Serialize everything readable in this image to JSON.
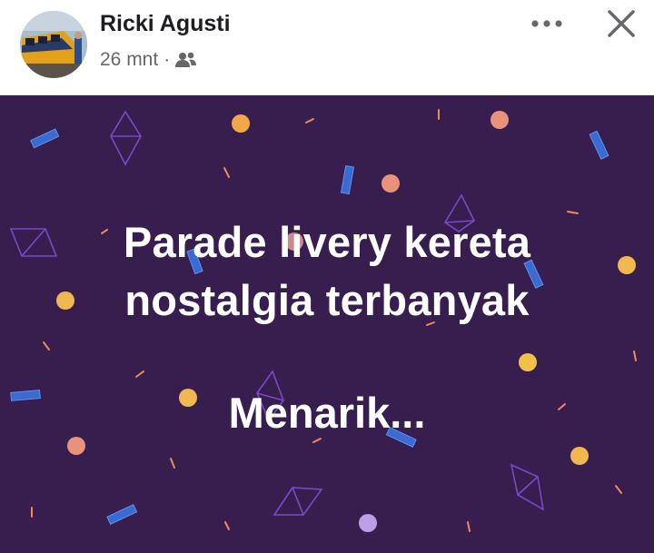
{
  "post": {
    "author_name": "Ricki Agusti",
    "timestamp": "26 mnt",
    "separator": "·",
    "audience_icon": "friends-icon",
    "more_icon": "more-options-icon",
    "close_icon": "close-icon",
    "background_color": "#371e4f",
    "text_lines": [
      "Parade livery kereta",
      "nostalgia terbanyak",
      "Menarik..."
    ]
  }
}
